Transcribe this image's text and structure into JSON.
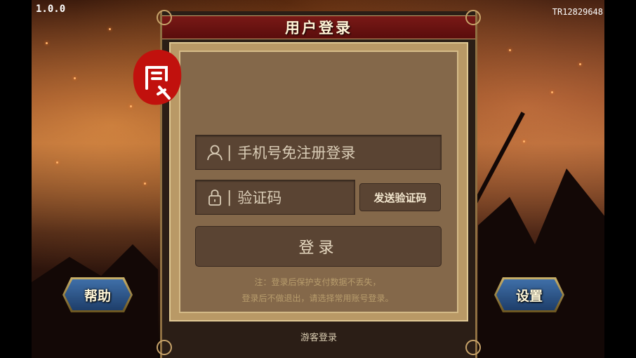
{
  "app": {
    "version": "1.0.0",
    "build_code": "TR12829648"
  },
  "dialog": {
    "title": "用户登录",
    "phone_placeholder": "手机号免注册登录",
    "code_placeholder": "验证码",
    "field_separator": "|",
    "send_code_label": "发送验证码",
    "login_label": "登录",
    "note_line1": "注：登录后保护支付数据不丢失，",
    "note_line2": "登录后不做退出，请选择常用账号登录。",
    "guest_login_label": "游客登录"
  },
  "side_buttons": {
    "help_label": "帮助",
    "settings_label": "设置"
  },
  "icons": {
    "user": "user-icon",
    "lock": "lock-icon",
    "seal": "seal-logo"
  },
  "colors": {
    "title_bar": "#7a1916",
    "panel_frame": "#b99966",
    "field_bg": "#5a4433",
    "button_blue": "#2f5c93",
    "seal_red": "#c1110d"
  }
}
